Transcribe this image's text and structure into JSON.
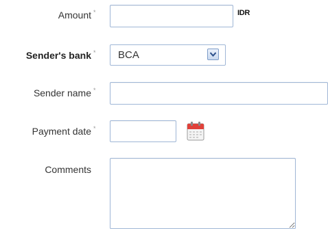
{
  "form": {
    "amount": {
      "label": "Amount",
      "required_mark": "*",
      "value": "",
      "currency": "IDR"
    },
    "sender_bank": {
      "label": "Sender's bank",
      "required_mark": "*",
      "selected": "BCA",
      "icon": "chevron-down-icon"
    },
    "sender_name": {
      "label": "Sender name",
      "required_mark": "*",
      "value": ""
    },
    "payment_date": {
      "label": "Payment date",
      "required_mark": "*",
      "value": "",
      "icon": "calendar-icon"
    },
    "comments": {
      "label": "Comments",
      "value": ""
    }
  },
  "colors": {
    "field_border": "#9fb6d6",
    "calendar_red": "#e0413a"
  }
}
